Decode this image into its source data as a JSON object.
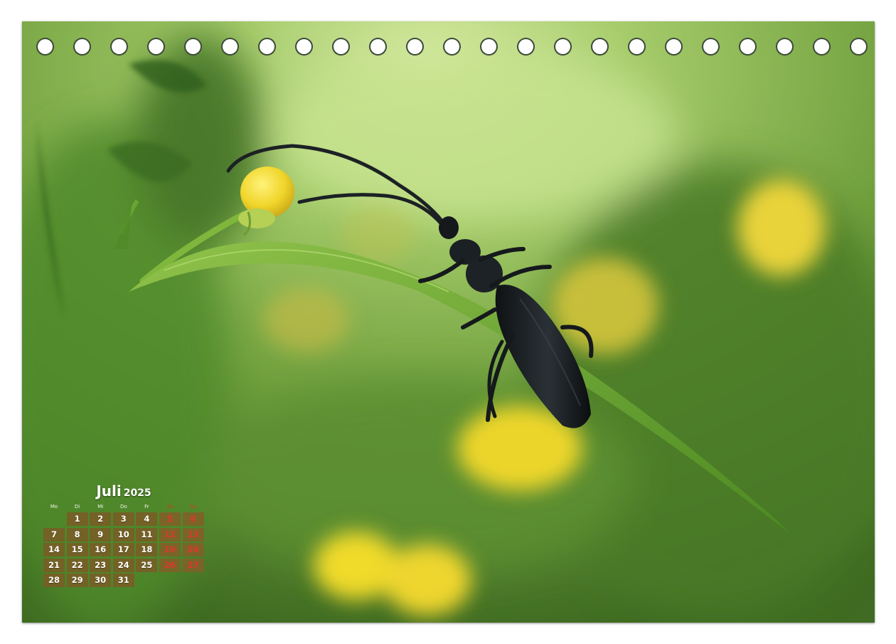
{
  "calendar": {
    "month": "Juli",
    "year": "2025",
    "weekdays": [
      "Mo",
      "Di",
      "Mi",
      "Do",
      "Fr",
      "Sa",
      "So"
    ],
    "weeks": [
      [
        "",
        "1",
        "2",
        "3",
        "4",
        "5",
        "6"
      ],
      [
        "7",
        "8",
        "9",
        "10",
        "11",
        "12",
        "13"
      ],
      [
        "14",
        "15",
        "16",
        "17",
        "18",
        "19",
        "20"
      ],
      [
        "21",
        "22",
        "23",
        "24",
        "25",
        "26",
        "27"
      ],
      [
        "28",
        "29",
        "30",
        "31",
        "",
        "",
        ""
      ]
    ]
  },
  "binding": {
    "hole_count": 23
  },
  "photo": {
    "subject": "black longhorn beetle on grass blade",
    "colors": {
      "background": "#6b9a3a",
      "flower": "#f0dc2a",
      "beetle": "#1a1e22",
      "cell": "#7a5c26",
      "weekend_text": "#e2352a"
    }
  }
}
